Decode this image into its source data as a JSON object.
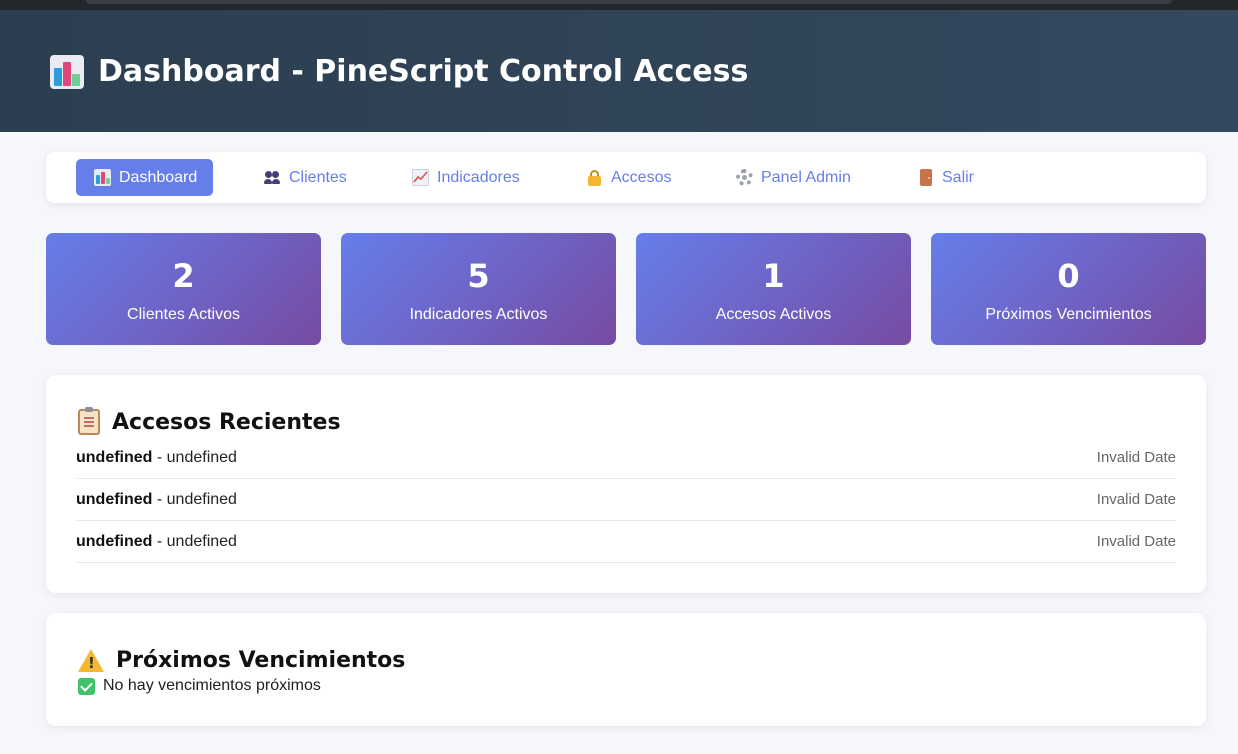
{
  "header": {
    "title": "Dashboard - PineScript Control Access",
    "icon": "bar-chart-icon"
  },
  "nav": {
    "items": [
      {
        "label": "Dashboard",
        "icon": "bar-chart-icon",
        "active": true
      },
      {
        "label": "Clientes",
        "icon": "users-icon"
      },
      {
        "label": "Indicadores",
        "icon": "trend-chart-icon"
      },
      {
        "label": "Accesos",
        "icon": "lock-icon"
      },
      {
        "label": "Panel Admin",
        "icon": "gear-icon"
      },
      {
        "label": "Salir",
        "icon": "door-icon"
      }
    ]
  },
  "stats": [
    {
      "value": "2",
      "label": "Clientes Activos"
    },
    {
      "value": "5",
      "label": "Indicadores Activos"
    },
    {
      "value": "1",
      "label": "Accesos Activos"
    },
    {
      "value": "0",
      "label": "Próximos Vencimientos"
    }
  ],
  "recent_access": {
    "title": "Accesos Recientes",
    "icon": "clipboard-icon",
    "rows": [
      {
        "client": "undefined",
        "indicator": "undefined",
        "date": "Invalid Date"
      },
      {
        "client": "undefined",
        "indicator": "undefined",
        "date": "Invalid Date"
      },
      {
        "client": "undefined",
        "indicator": "undefined",
        "date": "Invalid Date"
      }
    ]
  },
  "upcoming": {
    "title": "Próximos Vencimientos",
    "icon": "warning-icon",
    "empty_message": "No hay vencimientos próximos",
    "empty_icon": "check-icon"
  },
  "colors": {
    "header_bg": "#2c3e50",
    "accent": "#667eea",
    "stat_gradient_start": "#667eea",
    "stat_gradient_end": "#764ba2"
  }
}
